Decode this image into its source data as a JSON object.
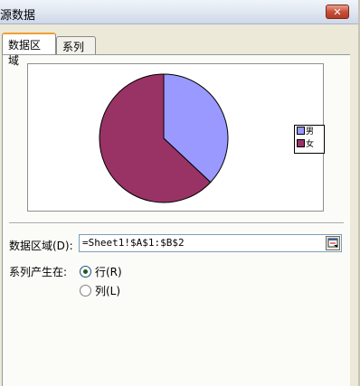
{
  "window": {
    "title": "源数据",
    "close_glyph": "✕"
  },
  "tabs": [
    {
      "label": "数据区域"
    },
    {
      "label": "系列"
    }
  ],
  "chart_data": {
    "type": "pie",
    "categories": [
      "男",
      "女"
    ],
    "values": [
      37,
      63
    ],
    "colors": [
      "#9999ff",
      "#993366"
    ],
    "legend_position": "right"
  },
  "data_range": {
    "label": "数据区域(D):",
    "value": "=Sheet1!$A$1:$B$2"
  },
  "series_in": {
    "label": "系列产生在:",
    "options": [
      {
        "label": "行(R)",
        "checked": true
      },
      {
        "label": "列(L)",
        "checked": false
      }
    ]
  }
}
